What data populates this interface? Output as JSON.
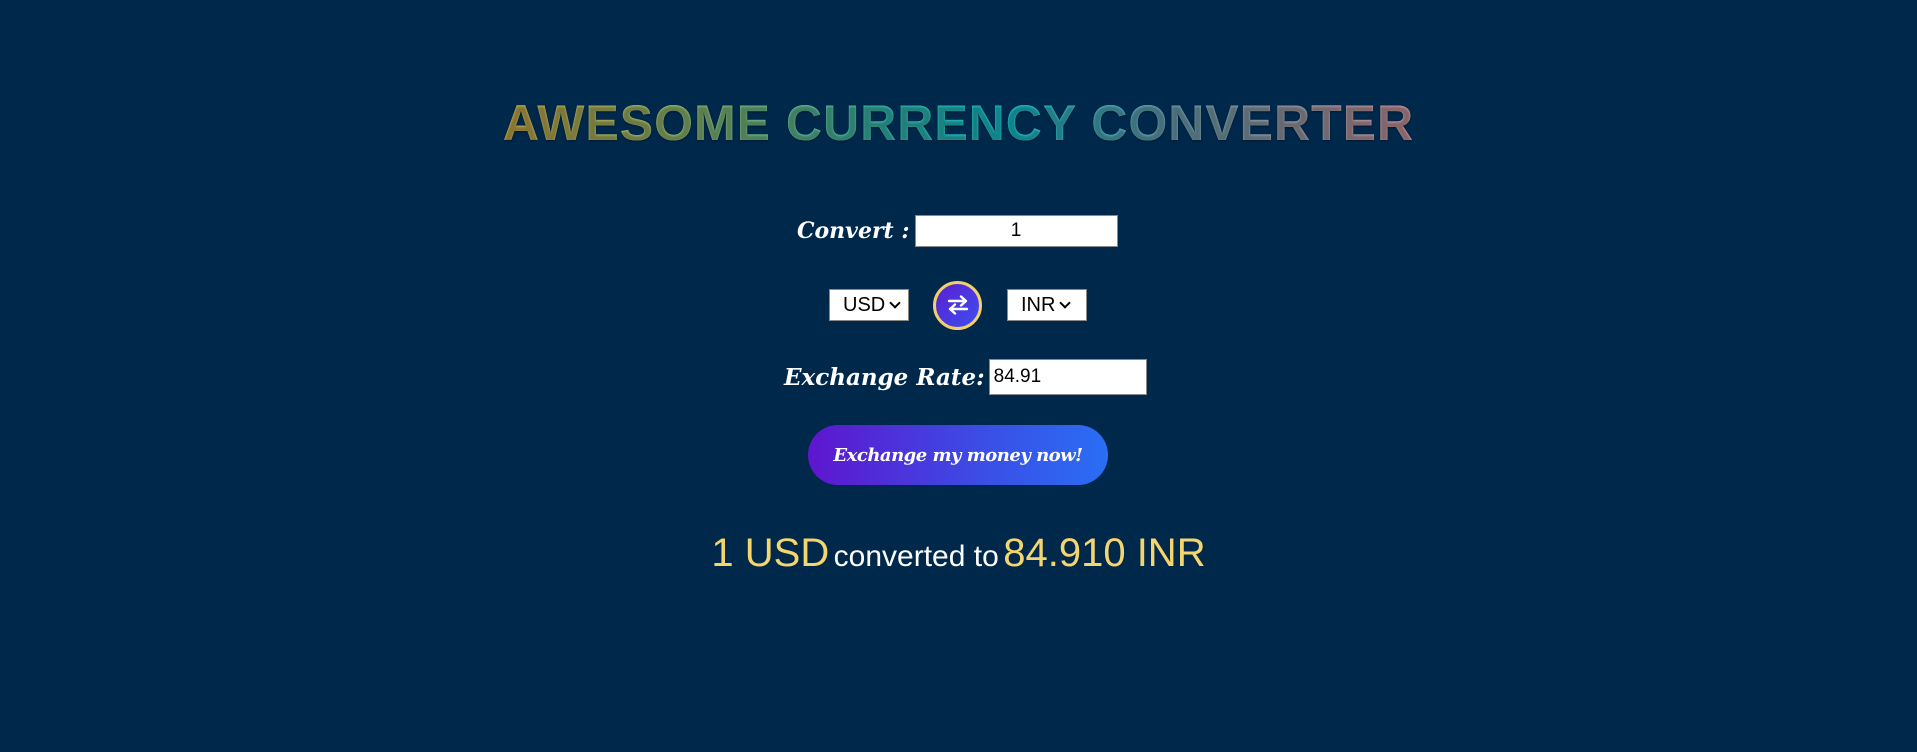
{
  "header": {
    "title": "AWESOME CURRENCY CONVERTER"
  },
  "converter": {
    "convert_label": "Convert :",
    "amount_value": "1",
    "from_currency": "USD",
    "to_currency": "INR",
    "swap_icon": "swap-arrows-icon",
    "rate_label": "Exchange Rate:",
    "rate_value": "84.91",
    "exchange_button_label": "Exchange my money now!"
  },
  "result": {
    "from_amount": "1 USD",
    "connector": "converted to",
    "to_amount": "84.910 INR"
  },
  "colors": {
    "background": "#00284b",
    "accent_gold": "#f5d66e",
    "button_gradient_start": "#5e16cf",
    "button_gradient_end": "#2a6ef5"
  }
}
